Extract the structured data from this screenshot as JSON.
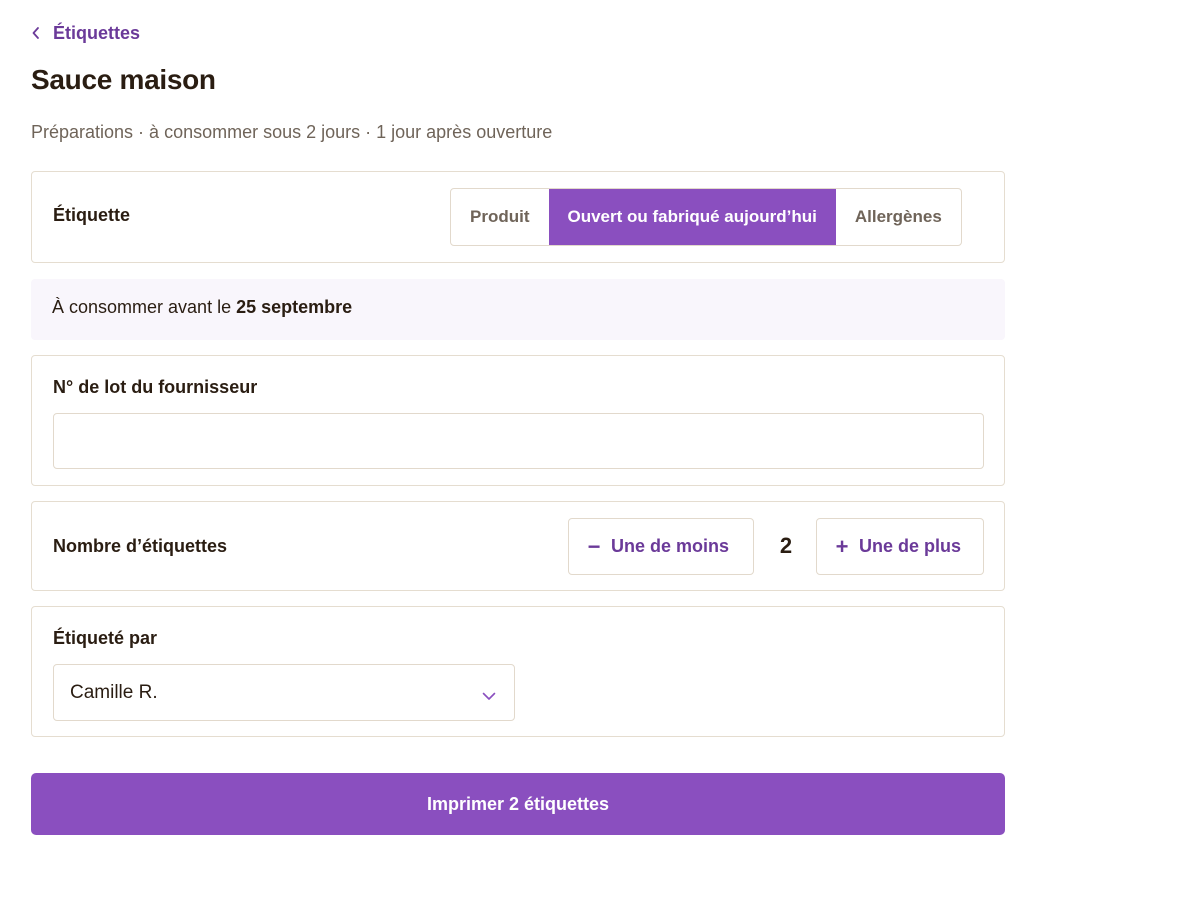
{
  "nav": {
    "back_label": "Étiquettes",
    "back_icon": "chevron-left-icon"
  },
  "page": {
    "title": "Sauce maison",
    "subtitle": "Préparations · à consommer sous 2 jours · 1 jour après ouverture"
  },
  "label_type": {
    "label": "Étiquette",
    "options": [
      "Produit",
      "Ouvert ou fabriqué aujourd’hui",
      "Allergènes"
    ],
    "selected": "Ouvert ou fabriqué aujourd’hui"
  },
  "expiry": {
    "prefix": "À consommer avant le ",
    "date": "25 septembre"
  },
  "lot": {
    "label": "N° de lot du fournisseur",
    "value": "",
    "placeholder": ""
  },
  "quantity": {
    "label": "Nombre d’étiquettes",
    "minus_symbol": "−",
    "minus_label": "Une de moins",
    "count": "2",
    "plus_symbol": "+",
    "plus_label": "Une de plus"
  },
  "labeled_by": {
    "label": "Étiqueté par",
    "selected": "Camille R.",
    "icon": "chevron-down-icon"
  },
  "print_button": {
    "label": "Imprimer 2 étiquettes"
  },
  "colors": {
    "accent": "#8a4fbf",
    "accent_text": "#6b3a99",
    "notice_bg": "#f9f6fc",
    "border": "#e5ddd0",
    "text": "#2a1d12",
    "muted": "#6f6459"
  }
}
